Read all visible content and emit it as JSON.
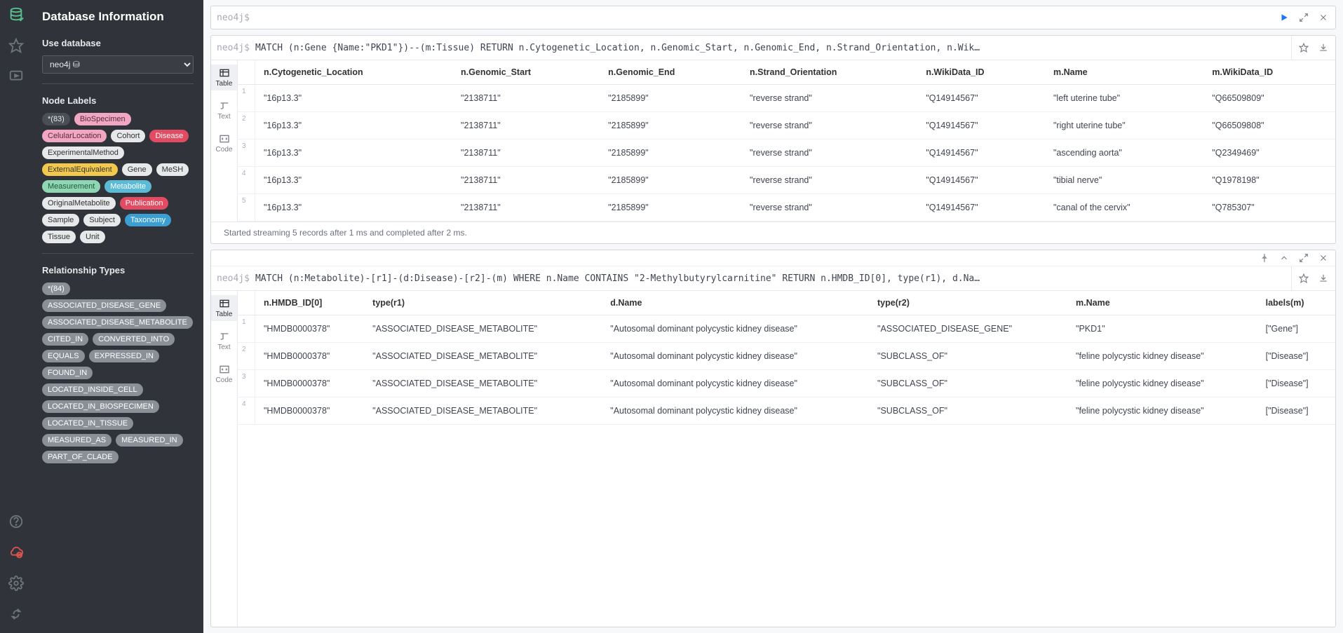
{
  "sidebar": {
    "title": "Database Information",
    "use_db_label": "Use database",
    "db_selected": "neo4j ⛁",
    "node_labels_heading": "Node Labels",
    "node_labels": [
      {
        "t": "*(83)",
        "bg": "#4a4e55",
        "fg": "#e6e8ea"
      },
      {
        "t": "BioSpecimen",
        "bg": "#f1a7c1",
        "fg": "#5a2a3d"
      },
      {
        "t": "CelularLocation",
        "bg": "#f1a7c1",
        "fg": "#5a2a3d"
      },
      {
        "t": "Cohort",
        "bg": "#e6e8ea",
        "fg": "#333"
      },
      {
        "t": "Disease",
        "bg": "#e34b63",
        "fg": "#fff"
      },
      {
        "t": "ExperimentalMethod",
        "bg": "#e6e8ea",
        "fg": "#333"
      },
      {
        "t": "ExternalEquivalent",
        "bg": "#f2c94c",
        "fg": "#333"
      },
      {
        "t": "Gene",
        "bg": "#e6e8ea",
        "fg": "#333"
      },
      {
        "t": "MeSH",
        "bg": "#e6e8ea",
        "fg": "#333"
      },
      {
        "t": "Measurement",
        "bg": "#8fd6b3",
        "fg": "#1e5a40"
      },
      {
        "t": "Metabolite",
        "bg": "#5bbad5",
        "fg": "#fff"
      },
      {
        "t": "OriginalMetabolite",
        "bg": "#e6e8ea",
        "fg": "#333"
      },
      {
        "t": "Publication",
        "bg": "#e34b63",
        "fg": "#fff"
      },
      {
        "t": "Sample",
        "bg": "#e6e8ea",
        "fg": "#333"
      },
      {
        "t": "Subject",
        "bg": "#e6e8ea",
        "fg": "#333"
      },
      {
        "t": "Taxonomy",
        "bg": "#3b9fd4",
        "fg": "#fff"
      },
      {
        "t": "Tissue",
        "bg": "#e6e8ea",
        "fg": "#333"
      },
      {
        "t": "Unit",
        "bg": "#e6e8ea",
        "fg": "#333"
      }
    ],
    "rel_heading": "Relationship Types",
    "rels": [
      "*(84)",
      "ASSOCIATED_DISEASE_GENE",
      "ASSOCIATED_DISEASE_METABOLITE",
      "CITED_IN",
      "CONVERTED_INTO",
      "EQUALS",
      "EXPRESSED_IN",
      "FOUND_IN",
      "LOCATED_INSIDE_CELL",
      "LOCATED_IN_BIOSPECIMEN",
      "LOCATED_IN_TISSUE",
      "MEASURED_AS",
      "MEASURED_IN",
      "PART_OF_CLADE"
    ]
  },
  "editor": {
    "prompt": "neo4j$"
  },
  "views": {
    "table": "Table",
    "text": "Text",
    "code": "Code"
  },
  "frame1": {
    "prompt": "neo4j$",
    "query": "MATCH (n:Gene {Name:\"PKD1\"})--(m:Tissue) RETURN n.Cytogenetic_Location, n.Genomic_Start, n.Genomic_End, n.Strand_Orientation, n.Wik…",
    "columns": [
      "n.Cytogenetic_Location",
      "n.Genomic_Start",
      "n.Genomic_End",
      "n.Strand_Orientation",
      "n.WikiData_ID",
      "m.Name",
      "m.WikiData_ID"
    ],
    "rows": [
      [
        "\"16p13.3\"",
        "\"2138711\"",
        "\"2185899\"",
        "\"reverse strand\"",
        "\"Q14914567\"",
        "\"left uterine tube\"",
        "\"Q66509809\""
      ],
      [
        "\"16p13.3\"",
        "\"2138711\"",
        "\"2185899\"",
        "\"reverse strand\"",
        "\"Q14914567\"",
        "\"right uterine tube\"",
        "\"Q66509808\""
      ],
      [
        "\"16p13.3\"",
        "\"2138711\"",
        "\"2185899\"",
        "\"reverse strand\"",
        "\"Q14914567\"",
        "\"ascending aorta\"",
        "\"Q2349469\""
      ],
      [
        "\"16p13.3\"",
        "\"2138711\"",
        "\"2185899\"",
        "\"reverse strand\"",
        "\"Q14914567\"",
        "\"tibial nerve\"",
        "\"Q1978198\""
      ],
      [
        "\"16p13.3\"",
        "\"2138711\"",
        "\"2185899\"",
        "\"reverse strand\"",
        "\"Q14914567\"",
        "\"canal of the cervix\"",
        "\"Q785307\""
      ]
    ],
    "footer": "Started streaming 5 records after 1 ms and completed after 2 ms."
  },
  "frame2": {
    "prompt": "neo4j$",
    "query": "MATCH (n:Metabolite)-[r1]-(d:Disease)-[r2]-(m) WHERE n.Name CONTAINS \"2-Methylbutyrylcarnitine\" RETURN n.HMDB_ID[0], type(r1), d.Na…",
    "columns": [
      "n.HMDB_ID[0]",
      "type(r1)",
      "d.Name",
      "type(r2)",
      "m.Name",
      "labels(m)"
    ],
    "rows": [
      [
        "\"HMDB0000378\"",
        "\"ASSOCIATED_DISEASE_METABOLITE\"",
        "\"Autosomal  dominant polycystic kidney disease\"",
        "\"ASSOCIATED_DISEASE_GENE\"",
        "\"PKD1\"",
        "[\"Gene\"]"
      ],
      [
        "\"HMDB0000378\"",
        "\"ASSOCIATED_DISEASE_METABOLITE\"",
        "\"Autosomal  dominant polycystic kidney disease\"",
        "\"SUBCLASS_OF\"",
        "\"feline  polycystic kidney disease\"",
        "[\"Disease\"]"
      ],
      [
        "\"HMDB0000378\"",
        "\"ASSOCIATED_DISEASE_METABOLITE\"",
        "\"Autosomal  dominant polycystic kidney disease\"",
        "\"SUBCLASS_OF\"",
        "\"feline  polycystic kidney disease\"",
        "[\"Disease\"]"
      ],
      [
        "\"HMDB0000378\"",
        "\"ASSOCIATED_DISEASE_METABOLITE\"",
        "\"Autosomal  dominant polycystic kidney disease\"",
        "\"SUBCLASS_OF\"",
        "\"feline  polycystic kidney disease\"",
        "[\"Disease\"]"
      ]
    ]
  }
}
